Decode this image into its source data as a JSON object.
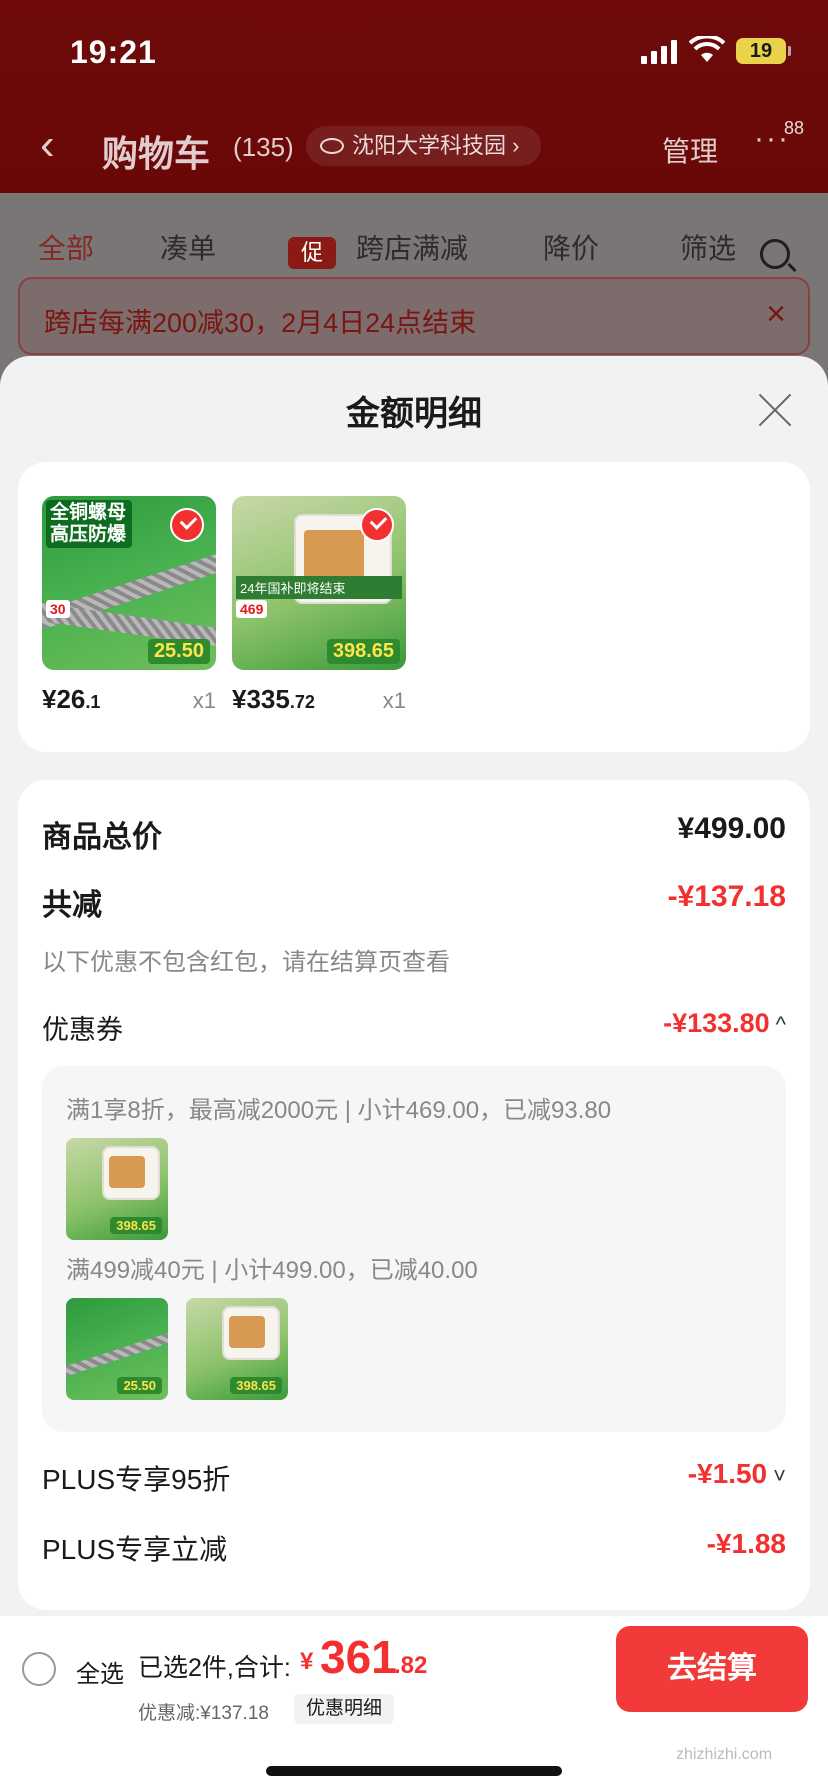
{
  "status": {
    "time": "19:21",
    "battery": "19"
  },
  "nav": {
    "back_icon": "chevron-left-icon",
    "title": "购物车",
    "count": "(135)",
    "location": "沈阳大学科技园",
    "location_arrow": "›",
    "manage": "管理",
    "more": "···",
    "more_badge": "88"
  },
  "tabs": [
    {
      "label": "全部"
    },
    {
      "label": "凑单"
    },
    {
      "label": "跨店满减",
      "tag": "促"
    },
    {
      "label": "降价"
    },
    {
      "label": "筛选"
    }
  ],
  "banner": {
    "text": "跨店每满200减30，2月4日24点结束",
    "close": "×"
  },
  "sheet": {
    "title": "金额明细",
    "products": [
      {
        "title": "全铜螺母高压防爆",
        "price_main": "¥26",
        "price_dec": ".1",
        "qty": "x1",
        "art_label": "30",
        "art_price": "25.50"
      },
      {
        "title": "24年国补即将结束",
        "price_main": "¥335",
        "price_dec": ".72",
        "qty": "x1",
        "art_label": "469",
        "art_price": "398.65"
      }
    ],
    "total_label": "商品总价",
    "total_value": "¥499.00",
    "reduce_label": "共减",
    "reduce_value": "-¥137.18",
    "note": "以下优惠不包含红包，请在结算页查看",
    "coupon_label": "优惠券",
    "coupon_value": "-¥133.80",
    "coupon_toggle": "^",
    "coupon_rows": [
      "满1享8折，最高减2000元 | 小计469.00，已减93.80",
      "满499减40元 | 小计499.00，已减40.00"
    ],
    "plus_rows": [
      {
        "label": "PLUS专享95折",
        "value": "-¥1.50",
        "toggle": "˅"
      },
      {
        "label": "PLUS专享立减",
        "value": "-¥1.88",
        "toggle": ""
      }
    ]
  },
  "bottom": {
    "select_all": "全选",
    "selected_text": "已选2件,合计:",
    "yen": "¥",
    "total_main": "361",
    "total_dec": ".82",
    "discount": "优惠减:¥137.18",
    "detail_btn": "优惠明细",
    "checkout": "去结算"
  },
  "watermark": "zhizhizhi.com",
  "colors": {
    "accent": "#f23030",
    "header": "#6e0a0a"
  }
}
